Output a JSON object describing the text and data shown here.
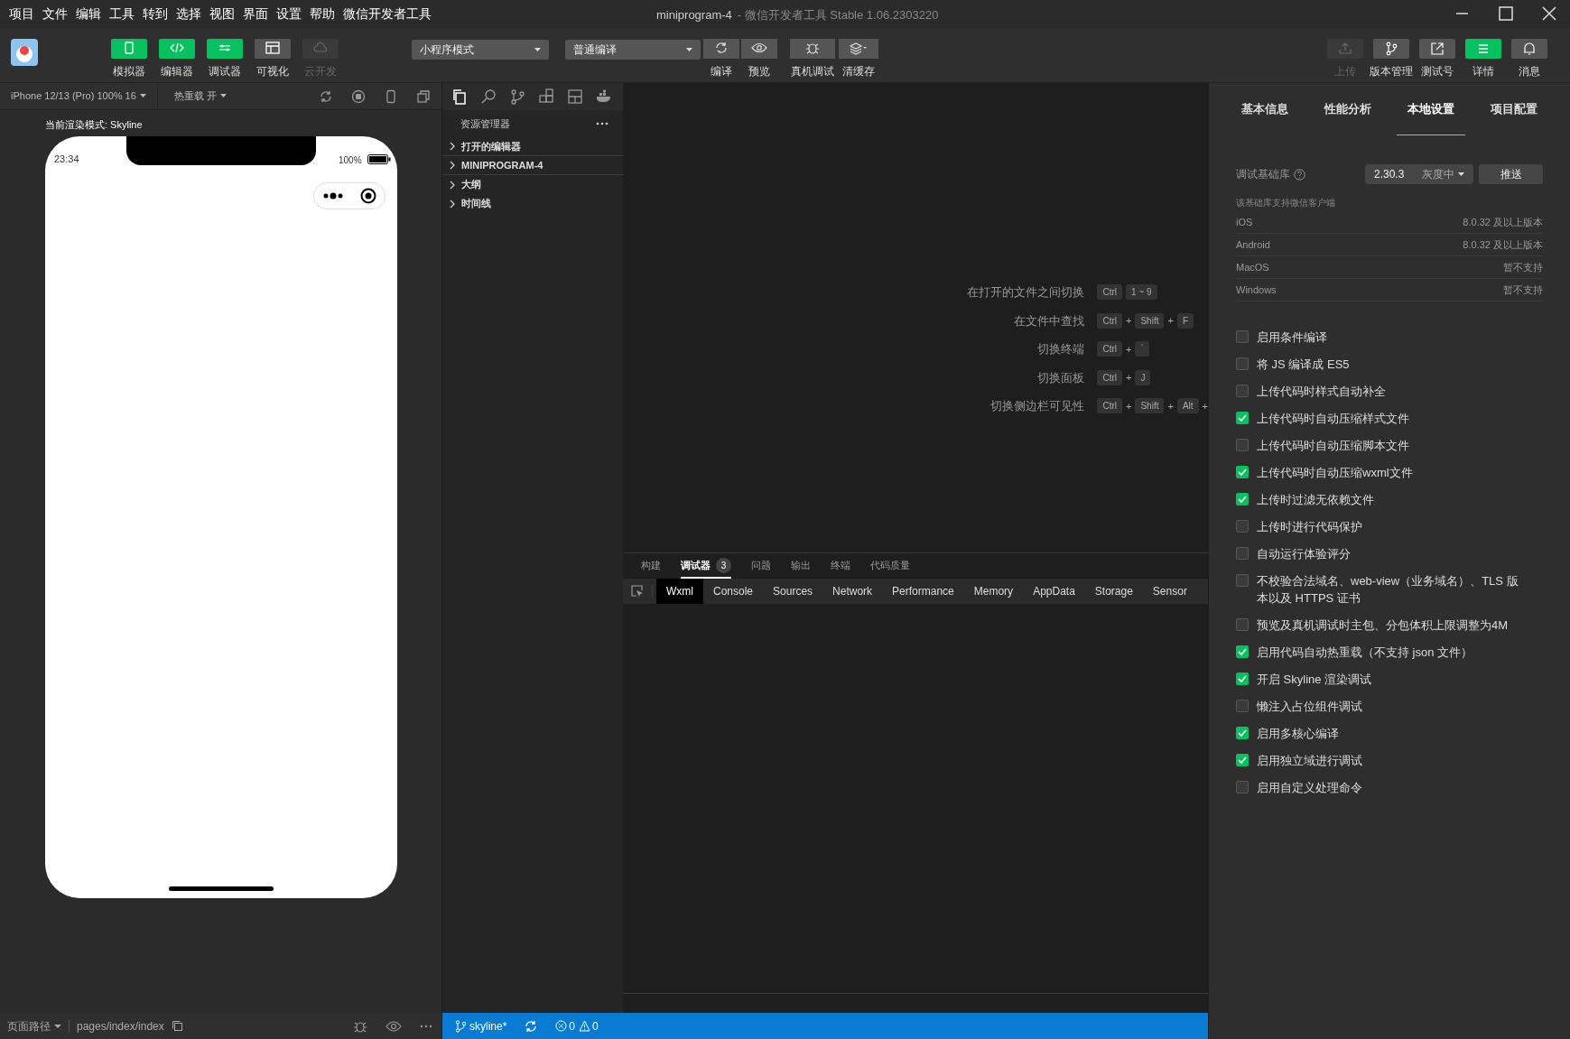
{
  "menu": [
    "项目",
    "文件",
    "编辑",
    "工具",
    "转到",
    "选择",
    "视图",
    "界面",
    "设置",
    "帮助",
    "微信开发者工具"
  ],
  "window": {
    "title": "miniprogram-4",
    "subtitle": "- 微信开发者工具 Stable 1.06.2303220"
  },
  "toolbar": {
    "left": [
      {
        "label": "模拟器",
        "on": true,
        "disabled": false
      },
      {
        "label": "编辑器",
        "on": true,
        "disabled": false
      },
      {
        "label": "调试器",
        "on": true,
        "disabled": false
      },
      {
        "label": "可视化",
        "on": false,
        "disabled": false
      },
      {
        "label": "云开发",
        "on": false,
        "disabled": true
      }
    ],
    "mode_dropdown": "小程序模式",
    "compile_dropdown": "普通编译",
    "actions": [
      "编译",
      "预览",
      "真机调试",
      "清缓存"
    ],
    "right": [
      {
        "label": "上传",
        "on": false,
        "disabled": true
      },
      {
        "label": "版本管理",
        "on": false,
        "disabled": false
      },
      {
        "label": "测试号",
        "on": false,
        "disabled": false
      },
      {
        "label": "详情",
        "on": true,
        "disabled": false
      },
      {
        "label": "消息",
        "on": false,
        "disabled": false
      }
    ]
  },
  "simulator": {
    "device": "iPhone 12/13 (Pro) 100% 16",
    "hot_reload": "热重载 开",
    "render_mode": "当前渲染模式: Skyline",
    "time": "23:34",
    "battery": "100%"
  },
  "explorer": {
    "title": "资源管理器",
    "sections": [
      "打开的编辑器",
      "MINIPROGRAM-4",
      "大纲",
      "时间线"
    ]
  },
  "shortcuts": [
    {
      "label": "在打开的文件之间切换",
      "keys": [
        {
          "kind": "key",
          "text": "Ctrl"
        },
        {
          "kind": "key",
          "text": "1 ~ 9"
        }
      ]
    },
    {
      "label": "在文件中查找",
      "keys": [
        {
          "kind": "key",
          "text": "Ctrl"
        },
        {
          "kind": "plus",
          "text": "+"
        },
        {
          "kind": "key",
          "text": "Shift"
        },
        {
          "kind": "plus",
          "text": "+"
        },
        {
          "kind": "key",
          "text": "F"
        }
      ]
    },
    {
      "label": "切换终端",
      "keys": [
        {
          "kind": "key",
          "text": "Ctrl"
        },
        {
          "kind": "plus",
          "text": "+"
        },
        {
          "kind": "key",
          "text": "`"
        }
      ]
    },
    {
      "label": "切换面板",
      "keys": [
        {
          "kind": "key",
          "text": "Ctrl"
        },
        {
          "kind": "plus",
          "text": "+"
        },
        {
          "kind": "key",
          "text": "J"
        }
      ]
    },
    {
      "label": "切换侧边栏可见性",
      "keys": [
        {
          "kind": "key",
          "text": "Ctrl"
        },
        {
          "kind": "plus",
          "text": "+"
        },
        {
          "kind": "key",
          "text": "Shift"
        },
        {
          "kind": "plus",
          "text": "+"
        },
        {
          "kind": "key",
          "text": "Alt"
        },
        {
          "kind": "plus",
          "text": "+"
        }
      ]
    }
  ],
  "debug": {
    "tabs": [
      {
        "label": "构建",
        "selected": false
      },
      {
        "label": "调试器",
        "selected": true,
        "badge": "3"
      },
      {
        "label": "问题",
        "selected": false
      },
      {
        "label": "输出",
        "selected": false
      },
      {
        "label": "终端",
        "selected": false
      },
      {
        "label": "代码质量",
        "selected": false
      }
    ],
    "devtools_tabs": [
      {
        "label": "Wxml",
        "selected": true
      },
      {
        "label": "Console",
        "selected": false
      },
      {
        "label": "Sources",
        "selected": false
      },
      {
        "label": "Network",
        "selected": false
      },
      {
        "label": "Performance",
        "selected": false
      },
      {
        "label": "Memory",
        "selected": false
      },
      {
        "label": "AppData",
        "selected": false
      },
      {
        "label": "Storage",
        "selected": false
      },
      {
        "label": "Sensor",
        "selected": false
      }
    ]
  },
  "simulator_footer": {
    "page_path_label": "页面路径",
    "page_path": "pages/index/index"
  },
  "status_bar": {
    "branch": "skyline*",
    "errors": "0",
    "warnings": "0"
  },
  "details": {
    "tabs": [
      {
        "label": "基本信息",
        "selected": false
      },
      {
        "label": "性能分析",
        "selected": false
      },
      {
        "label": "本地设置",
        "selected": true
      },
      {
        "label": "项目配置",
        "selected": false
      }
    ],
    "base_lib": {
      "label": "调试基础库",
      "version": "2.30.3",
      "channel": "灰度中",
      "push": "推送"
    },
    "support_title": "该基础库支持微信客户端",
    "support": [
      {
        "platform": "iOS",
        "value": "8.0.32 及以上版本"
      },
      {
        "platform": "Android",
        "value": "8.0.32 及以上版本"
      },
      {
        "platform": "MacOS",
        "value": "暂不支持"
      },
      {
        "platform": "Windows",
        "value": "暂不支持"
      }
    ],
    "options": [
      {
        "label": "启用条件编译",
        "checked": false
      },
      {
        "label": "将 JS 编译成 ES5",
        "checked": false
      },
      {
        "label": "上传代码时样式自动补全",
        "checked": false
      },
      {
        "label": "上传代码时自动压缩样式文件",
        "checked": true
      },
      {
        "label": "上传代码时自动压缩脚本文件",
        "checked": false
      },
      {
        "label": "上传代码时自动压缩wxml文件",
        "checked": true
      },
      {
        "label": "上传时过滤无依赖文件",
        "checked": true
      },
      {
        "label": "上传时进行代码保护",
        "checked": false
      },
      {
        "label": "自动运行体验评分",
        "checked": false
      },
      {
        "label": "不校验合法域名、web-view（业务域名）、TLS 版本以及 HTTPS 证书",
        "checked": false
      },
      {
        "label": "预览及真机调试时主包、分包体积上限调整为4M",
        "checked": false
      },
      {
        "label": "启用代码自动热重载（不支持 json 文件）",
        "checked": true
      },
      {
        "label": "开启 Skyline 渲染调试",
        "checked": true
      },
      {
        "label": "懒注入占位组件调试",
        "checked": false
      },
      {
        "label": "启用多核心编译",
        "checked": true
      },
      {
        "label": "启用独立域进行调试",
        "checked": true
      },
      {
        "label": "启用自定义处理命令",
        "checked": false
      }
    ]
  }
}
